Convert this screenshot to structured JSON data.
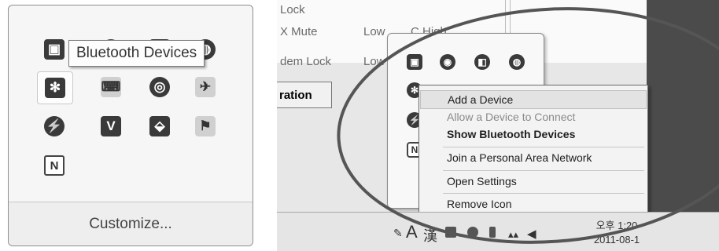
{
  "left_panel": {
    "tooltip": "Bluetooth Devices",
    "customize_label": "Customize...",
    "icons": [
      {
        "name": "display-icon",
        "glyph": "▣"
      },
      {
        "name": "sync-icon",
        "glyph": "◉"
      },
      {
        "name": "media-icon",
        "glyph": "◧"
      },
      {
        "name": "network-icon",
        "glyph": "◍"
      },
      {
        "name": "bluetooth-icon",
        "glyph": "✻"
      },
      {
        "name": "keyboard-icon",
        "glyph": "⌨"
      },
      {
        "name": "wireless-icon",
        "glyph": "◎"
      },
      {
        "name": "plane-icon",
        "glyph": "✈"
      },
      {
        "name": "power-icon",
        "glyph": "⚡"
      },
      {
        "name": "security-v-icon",
        "glyph": "V"
      },
      {
        "name": "pdf-icon",
        "glyph": "⬙"
      },
      {
        "name": "flag-icon",
        "glyph": "⚑"
      },
      {
        "name": "n-icon",
        "glyph": "N"
      }
    ]
  },
  "right_panel": {
    "bg_labels": {
      "lock": "Lock",
      "mute": "X Mute",
      "low": "Low",
      "high": "C High",
      "dem_lock": "dem Lock",
      "low2": "Low",
      "ration": "ration"
    },
    "popup_icons": [
      {
        "name": "display-icon",
        "glyph": "▣"
      },
      {
        "name": "sync-icon",
        "glyph": "◉"
      },
      {
        "name": "media-icon",
        "glyph": "◧"
      },
      {
        "name": "network-icon",
        "glyph": "◍"
      },
      {
        "name": "bluetooth-icon",
        "glyph": "✻"
      },
      {
        "name": "power-icon",
        "glyph": "⚡"
      },
      {
        "name": "n-icon",
        "glyph": "N"
      }
    ],
    "context_menu": {
      "add_device": "Add a Device",
      "allow_connect": "Allow a Device to Connect",
      "show_devices": "Show Bluetooth Devices",
      "join_pan": "Join a Personal Area Network",
      "open_settings": "Open Settings",
      "remove_icon": "Remove Icon"
    },
    "taskbar": {
      "lang": "A",
      "hanja": "漢",
      "time": "오후 1:20",
      "date": "2011-08-1"
    }
  },
  "colors": {
    "highlight": "#e3e3e3",
    "ellipse": "#555555"
  }
}
